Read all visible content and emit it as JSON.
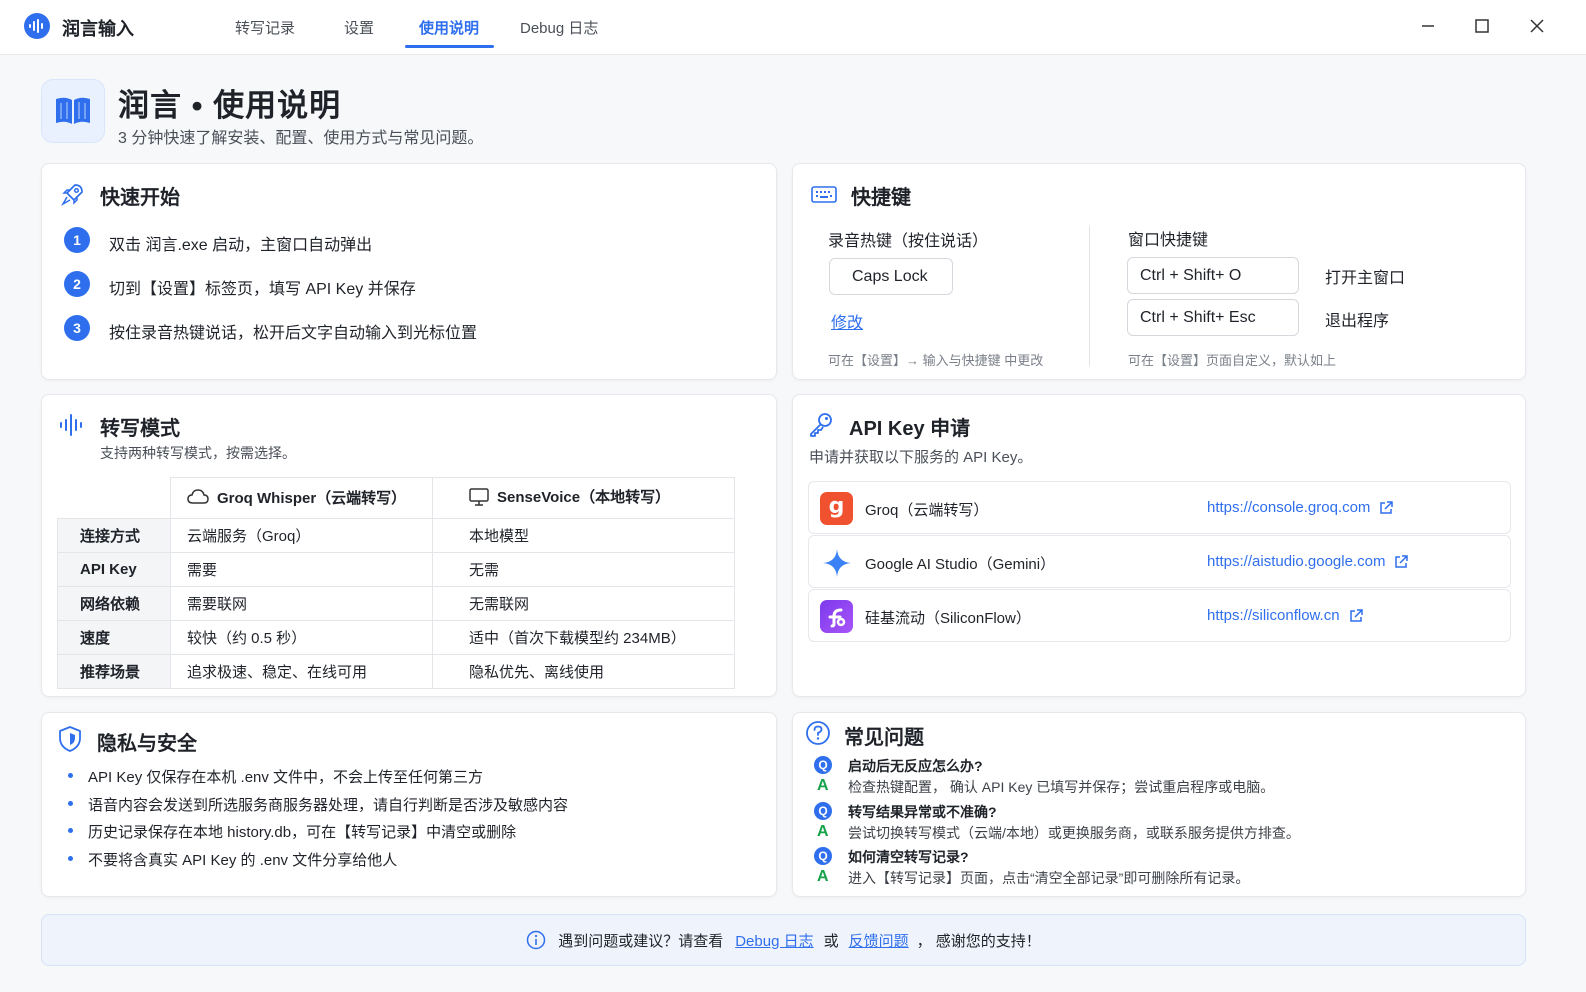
{
  "app": {
    "name": "润言输入"
  },
  "tabs": [
    {
      "label": "转写记录"
    },
    {
      "label": "设置"
    },
    {
      "label": "使用说明"
    },
    {
      "label": "Debug 日志"
    }
  ],
  "header": {
    "title": "润言 • 使用说明",
    "subtitle": "3 分钟快速了解安装、配置、使用方式与常见问题。"
  },
  "quick_start": {
    "title": "快速开始",
    "steps": [
      {
        "num": "1",
        "text": "双击 润言.exe 启动，主窗口自动弹出"
      },
      {
        "num": "2",
        "text": "切到【设置】标签页，填写 API Key 并保存"
      },
      {
        "num": "3",
        "text": "按住录音热键说话，松开后文字自动输入到光标位置"
      }
    ]
  },
  "shortcuts": {
    "title": "快捷键",
    "record_label": "录音热键（按住说话）",
    "record_key": "Caps Lock",
    "modify_link": "修改",
    "record_note": "可在【设置】→ 输入与快捷键 中更改",
    "window_label": "窗口快捷键",
    "window_items": [
      {
        "key": "Ctrl + Shift+ O",
        "action": "打开主窗口"
      },
      {
        "key": "Ctrl + Shift+ Esc",
        "action": "退出程序"
      }
    ],
    "window_note": "可在【设置】页面自定义，默认如上"
  },
  "modes": {
    "title": "转写模式",
    "subtitle": "支持两种转写模式，按需选择。",
    "col1": "Groq Whisper（云端转写）",
    "col2": "SenseVoice（本地转写）",
    "rows": [
      {
        "label": "连接方式",
        "a": "云端服务（Groq）",
        "b": "本地模型"
      },
      {
        "label": "API Key",
        "a": "需要",
        "b": "无需"
      },
      {
        "label": "网络依赖",
        "a": "需要联网",
        "b": "无需联网"
      },
      {
        "label": "速度",
        "a": "较快（约 0.5 秒）",
        "b": "适中（首次下载模型约 234MB）"
      },
      {
        "label": "推荐场景",
        "a": "追求极速、稳定、在线可用",
        "b": "隐私优先、离线使用"
      }
    ]
  },
  "api": {
    "title": "API Key 申请",
    "subtitle": "申请并获取以下服务的 API Key。",
    "providers": [
      {
        "name": "Groq（云端转写）",
        "url": "https://console.groq.com",
        "logo": "g",
        "color": "#f0512f"
      },
      {
        "name": "Google AI Studio（Gemini）",
        "url": "https://aistudio.google.com",
        "logo": "",
        "color": "#3b82f6"
      },
      {
        "name": "硅基流动（SiliconFlow）",
        "url": "https://siliconflow.cn",
        "logo": "",
        "color": "#7c3aed"
      }
    ]
  },
  "privacy": {
    "title": "隐私与安全",
    "items": [
      "API Key 仅保存在本机 .env 文件中，不会上传至任何第三方",
      "语音内容会发送到所选服务商服务器处理，请自行判断是否涉及敏感内容",
      "历史记录保存在本地 history.db，可在【转写记录】中清空或删除",
      "不要将含真实 API Key 的 .env 文件分享给他人"
    ]
  },
  "faq": {
    "title": "常见问题",
    "q_badge": "Q",
    "a_badge": "A",
    "items": [
      {
        "q": "启动后无反应怎么办?",
        "a": "检查热键配置， 确认 API Key 已填写并保存；尝试重启程序或电脑。"
      },
      {
        "q": "转写结果异常或不准确?",
        "a": "尝试切换转写模式（云端/本地）或更换服务商，或联系服务提供方排查。"
      },
      {
        "q": "如何清空转写记录?",
        "a": "进入【转写记录】页面，点击“清空全部记录”即可删除所有记录。"
      }
    ]
  },
  "footer": {
    "prefix": "遇到问题或建议？请查看",
    "debug_link": "Debug 日志",
    "or": "或",
    "feedback_link": "反馈问题",
    "suffix": "， 感谢您的支持！"
  },
  "colors": {
    "accent": "#2f6fed",
    "answer": "#16a34a"
  }
}
